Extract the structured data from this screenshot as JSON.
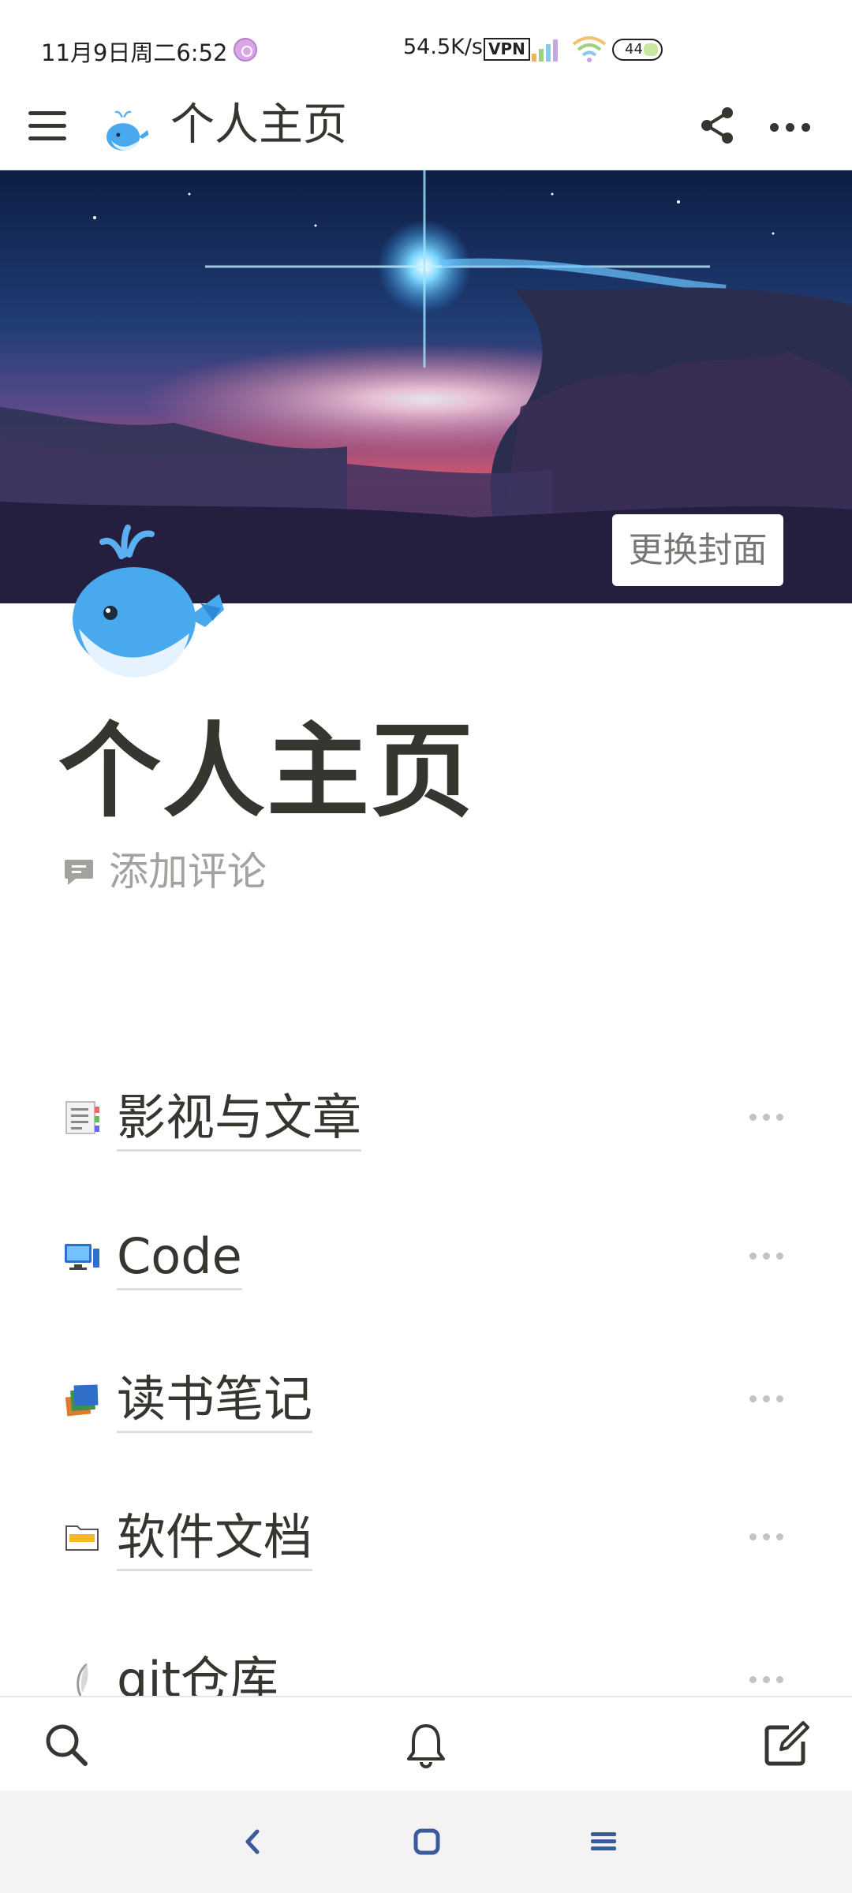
{
  "status_bar": {
    "time": "11月9日周二6:52",
    "network_speed": "54.5K/s",
    "vpn_label": "VPN",
    "battery_level": "44"
  },
  "app_bar": {
    "menu_icon": "hamburger-menu-icon",
    "page_icon": "whale-emoji",
    "title": "个人主页",
    "share_icon": "share-icon",
    "more_icon": "more-horizontal-icon"
  },
  "cover": {
    "change_cover_label": "更换封面"
  },
  "page": {
    "icon": "whale-emoji",
    "title": "个人主页",
    "add_comment_label": "添加评论"
  },
  "subpages": [
    {
      "icon": "document-emoji",
      "label": "影视与文章"
    },
    {
      "icon": "desktop-computer-emoji",
      "label": "Code"
    },
    {
      "icon": "books-emoji",
      "label": "读书笔记"
    },
    {
      "icon": "folder-emoji",
      "label": "软件文档"
    },
    {
      "icon": "feather-emoji",
      "label": "git仓库"
    }
  ],
  "bottom_bar": {
    "search_icon": "search-icon",
    "notifications_icon": "bell-icon",
    "new_page_icon": "compose-icon"
  },
  "nav_bar": {
    "back_icon": "back-icon",
    "home_icon": "home-icon",
    "recents_icon": "recents-icon"
  }
}
